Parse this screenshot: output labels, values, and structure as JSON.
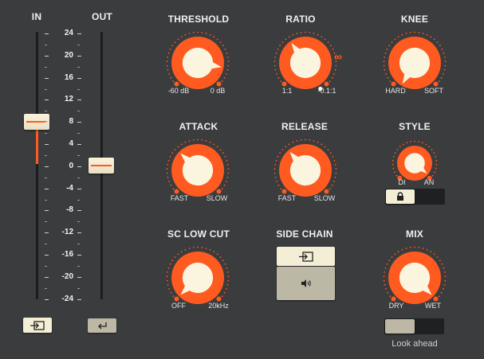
{
  "meters": {
    "in_label": "IN",
    "out_label": "OUT",
    "scale": [
      "24",
      "20",
      "16",
      "12",
      "8",
      "4",
      "0",
      "-4",
      "-8",
      "-12",
      "-16",
      "-20",
      "-24"
    ],
    "in_level_db": 8,
    "out_level_db": 0,
    "in_button_icon": "input-icon",
    "out_button_icon": "return-icon"
  },
  "threshold": {
    "label": "THRESHOLD",
    "min": "-60 dB",
    "max": "0 dB"
  },
  "ratio": {
    "label": "RATIO",
    "min": "1:1",
    "mid": "-0.1:1",
    "max_symbol": "∞"
  },
  "knee": {
    "label": "KNEE",
    "min": "HARD",
    "max": "SOFT"
  },
  "attack": {
    "label": "ATTACK",
    "min": "FAST",
    "max": "SLOW"
  },
  "release": {
    "label": "RELEASE",
    "min": "FAST",
    "max": "SLOW"
  },
  "style": {
    "label": "STYLE",
    "min": "DI",
    "max": "AN",
    "lock_icon": "lock-icon"
  },
  "sc_low_cut": {
    "label": "SC LOW CUT",
    "min": "OFF",
    "max": "20kHz"
  },
  "side_chain": {
    "label": "SIDE CHAIN",
    "top_icon": "input-icon",
    "bottom_icon": "speaker-icon"
  },
  "mix": {
    "label": "MIX",
    "min": "DRY",
    "max": "WET"
  },
  "look_ahead": {
    "label": "Look ahead"
  },
  "colors": {
    "knob_orange": "#ff5a1f",
    "knob_cap": "#fbf5e0",
    "background": "#3a3c3e"
  }
}
